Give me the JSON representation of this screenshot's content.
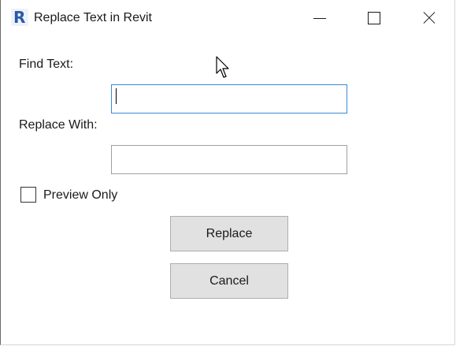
{
  "window": {
    "title": "Replace Text in Revit",
    "app_icon_letter": "R"
  },
  "form": {
    "find_label": "Find Text:",
    "find_value": "",
    "replace_label": "Replace With:",
    "replace_value": "",
    "preview_label": "Preview Only",
    "preview_checked": false
  },
  "buttons": {
    "replace_label": "Replace",
    "cancel_label": "Cancel"
  },
  "icons": {
    "app": "revit-r-icon",
    "minimize": "minimize-icon",
    "maximize": "maximize-icon",
    "close": "close-icon",
    "cursor": "mouse-pointer-icon"
  },
  "colors": {
    "focus_border": "#3a8ad4",
    "button_bg": "#e1e1e1",
    "app_icon": "#2a5aa6"
  }
}
